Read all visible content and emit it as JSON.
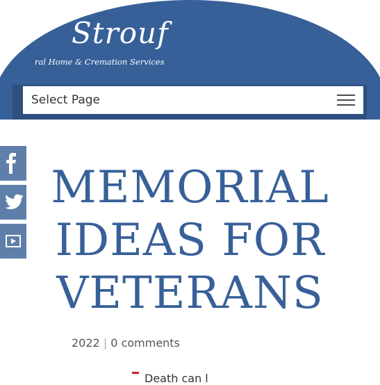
{
  "logo": {
    "name": "Strouf",
    "tagline": "ral Home & Cremation Services"
  },
  "nav": {
    "label": "Select Page",
    "menu_icon": "hamburger-icon"
  },
  "social": [
    {
      "name": "facebook-icon"
    },
    {
      "name": "twitter-icon"
    },
    {
      "name": "youtube-icon"
    }
  ],
  "article": {
    "title_lines": [
      "MEMORIAL",
      "IDEAS FOR",
      "VETERANS"
    ],
    "date_partial": "2022",
    "separator": "|",
    "comments": "0 comments",
    "snippet_partial": "Death can l"
  },
  "colors": {
    "brand": "#376099",
    "nav_shadow": "#2f4f7e",
    "social_bg": "#5f7fab"
  }
}
